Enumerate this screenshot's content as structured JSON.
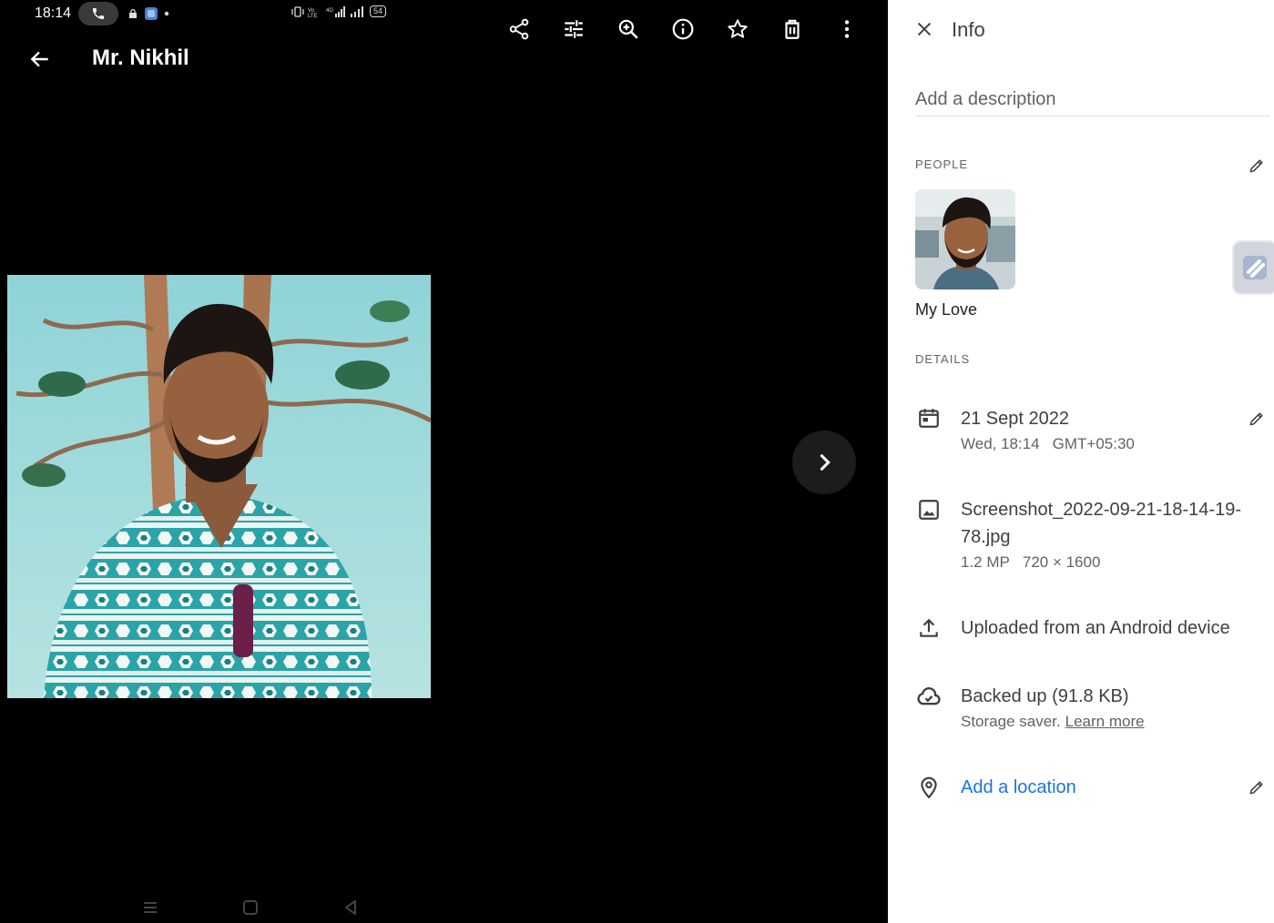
{
  "status_bar": {
    "time": "18:14",
    "battery": "54"
  },
  "viewer": {
    "title": "Mr. Nikhil",
    "toolbar": [
      "share-icon",
      "edit-adjust-icon",
      "zoom-in-icon",
      "info-icon",
      "star-icon",
      "delete-icon",
      "more-vert-icon"
    ]
  },
  "info_panel": {
    "title": "Info",
    "description_placeholder": "Add a description",
    "people_label": "PEOPLE",
    "person_name": "My Love",
    "details_label": "DETAILS",
    "date": {
      "main": "21 Sept 2022",
      "day_time": "Wed, 18:14",
      "timezone": "GMT+05:30"
    },
    "file": {
      "name_line1": "Screenshot_2022-09-21-18-14-19-",
      "name_line2": "78.jpg",
      "megapixels": "1.2 MP",
      "resolution": "720 × 1600"
    },
    "upload": {
      "text": "Uploaded from an Android device"
    },
    "backup": {
      "main": "Backed up (91.8 KB)",
      "sub": "Storage saver.",
      "link": "Learn more"
    },
    "location": {
      "text": "Add a location"
    }
  },
  "colors": {
    "viewer_bg": "#000000",
    "panel_bg": "#ffffff",
    "link_blue": "#1a73e8",
    "text_primary": "#3c4043",
    "text_secondary": "#5f6368"
  }
}
